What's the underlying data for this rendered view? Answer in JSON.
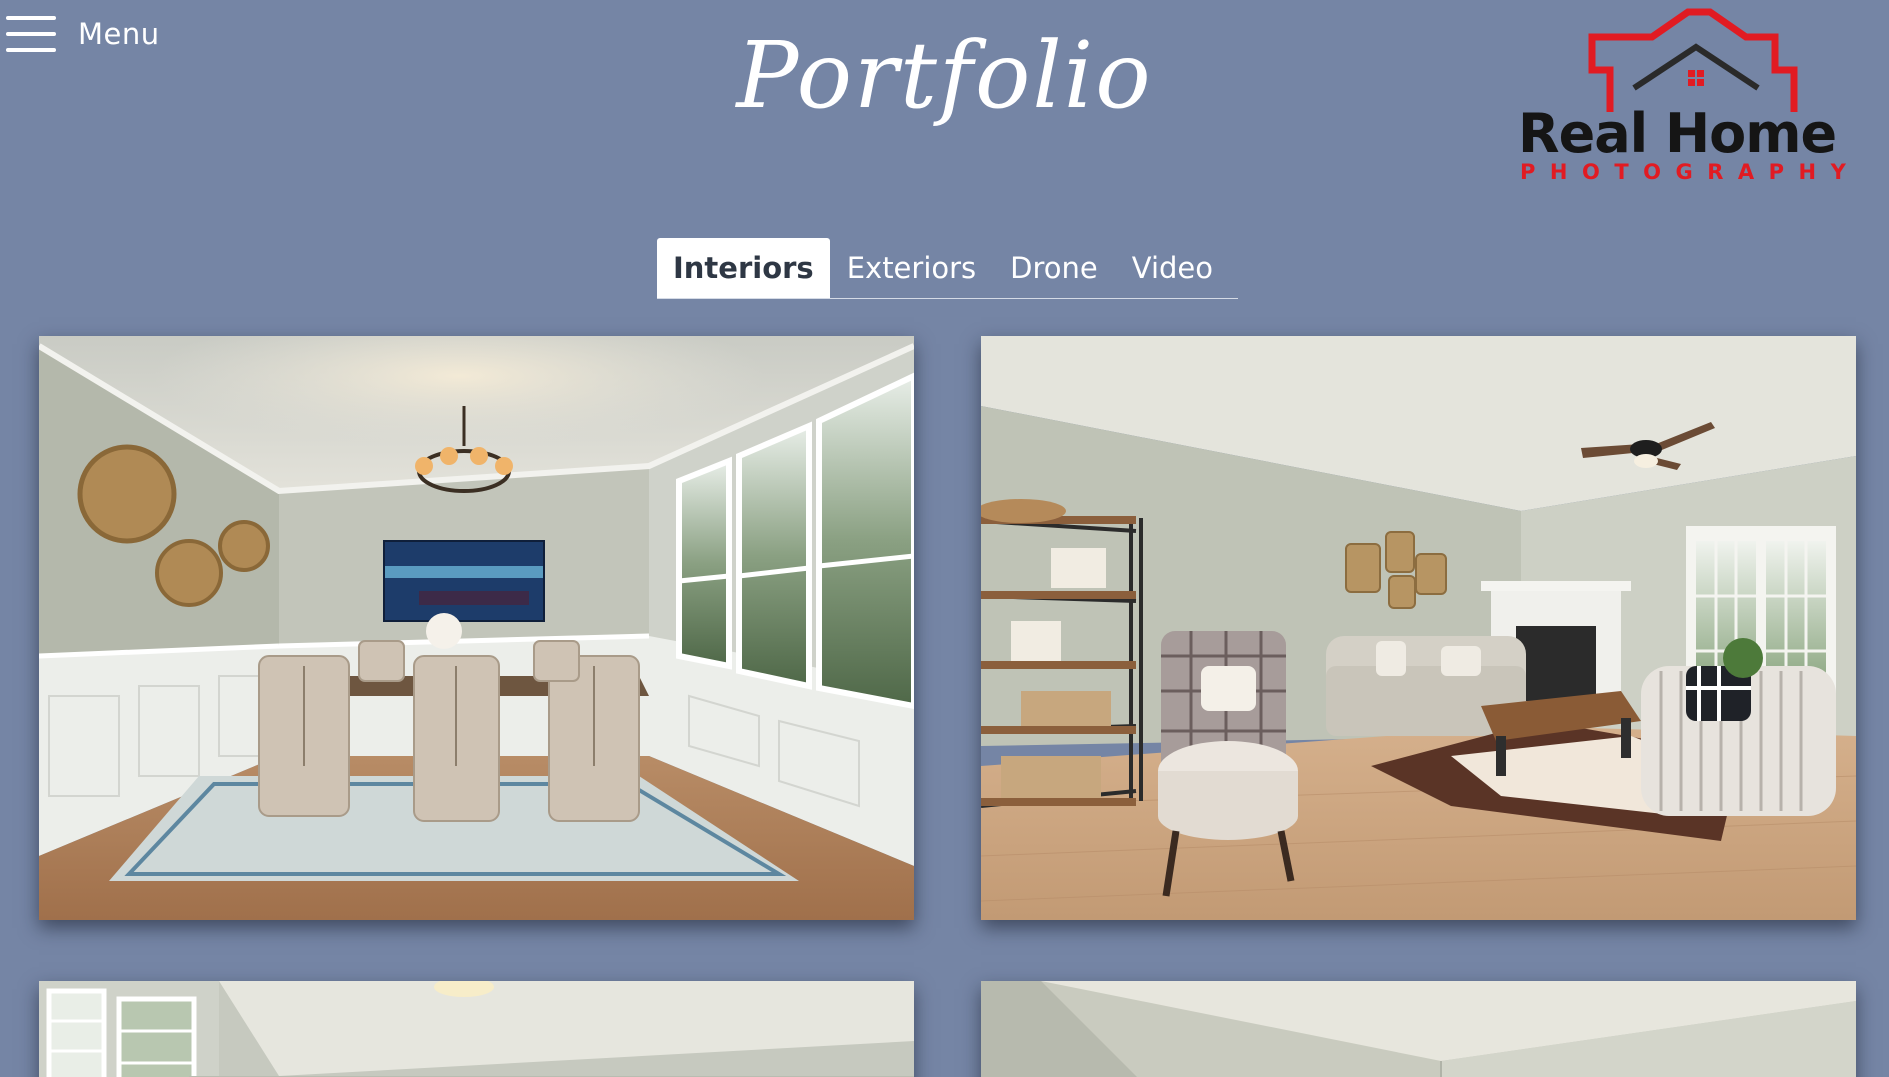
{
  "header": {
    "menu_label": "Menu",
    "title": "Portfolio",
    "icons": [
      "hamburger-menu-icon"
    ]
  },
  "logo": {
    "brand_line_1": "Real Home",
    "brand_line_2": "PHOTOGRAPHY",
    "colors": {
      "red": "#e11b22",
      "dark": "#151515"
    }
  },
  "tabs": [
    {
      "label": "Interiors",
      "active": true
    },
    {
      "label": "Exteriors",
      "active": false
    },
    {
      "label": "Drone",
      "active": false
    },
    {
      "label": "Video",
      "active": false
    }
  ],
  "gallery": {
    "photos": [
      {
        "subject": "dining-room"
      },
      {
        "subject": "living-room"
      },
      {
        "subject": "interior-with-windows"
      },
      {
        "subject": "interior-room"
      }
    ]
  },
  "theme": {
    "background": "#7585a5",
    "text": "#ffffff",
    "active_tab_text": "#2e3744"
  }
}
